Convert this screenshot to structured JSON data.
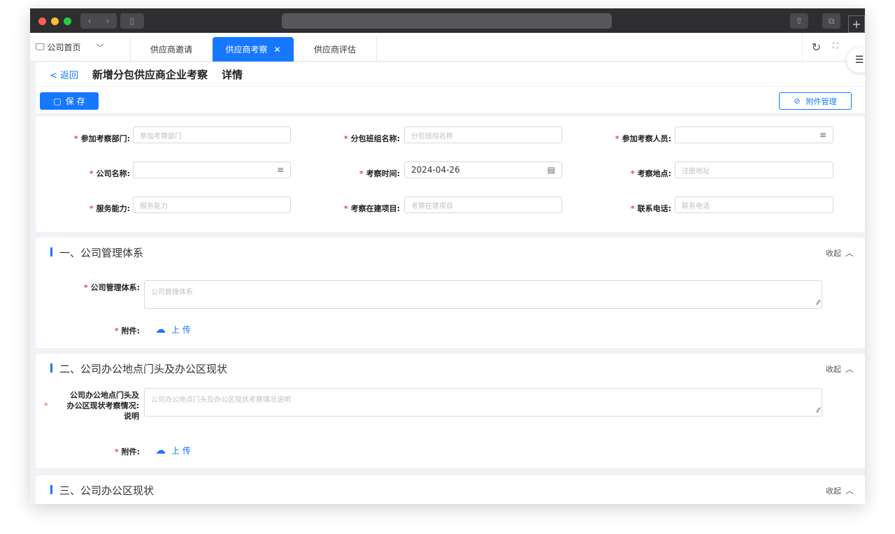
{
  "browser": {
    "nav_back_icon": "chevron-left-icon",
    "nav_forward_icon": "chevron-right-icon",
    "back_glyph": "‹",
    "forward_glyph": "›",
    "sidebar_glyph": "▯",
    "share_glyph": "⇧",
    "tabs_glyph": "⧉",
    "plus_glyph": "+"
  },
  "tabs": {
    "home_label": "公司首页",
    "home_icon_glyph": "🖵",
    "chevron_glyph": "﹀",
    "items": [
      {
        "label": "供应商邀请"
      },
      {
        "label": "供应商考察",
        "active": true
      },
      {
        "label": "供应商评估"
      }
    ],
    "close_glyph": "✕",
    "refresh_glyph": "↻",
    "fullscreen_glyph": "⛶",
    "settings_glyph": "☰"
  },
  "header": {
    "back_label": "< 返回",
    "title": "新增分包供应商企业考察",
    "subtitle": "详情"
  },
  "toolbar": {
    "save_label": "保 存",
    "save_icon_glyph": "▢",
    "attach_label": "附件管理",
    "attach_icon_glyph": "⊘"
  },
  "form": {
    "required_mark": "*",
    "dept_label": "参加考察部门:",
    "dept_placeholder": "参加考察部门",
    "team_label": "分包班组名称:",
    "team_placeholder": "分包班组名称",
    "staff_label": "参加考察人员:",
    "company_label": "公司名称:",
    "time_label": "考察时间:",
    "time_value": "2024-04-26",
    "place_label": "考察地点:",
    "place_placeholder": "注册地址",
    "service_label": "服务能力:",
    "service_placeholder": "服务能力",
    "project_label": "考察在建项目:",
    "project_placeholder": "考察在建项目",
    "phone_label": "联系电话:",
    "phone_placeholder": "联系电话",
    "filter_glyph": "≡",
    "calendar_glyph": "▤"
  },
  "sections": [
    {
      "title": "一、公司管理体系",
      "collapse_label": "收起",
      "field_label": "公司管理体系:",
      "field_placeholder": "公司管理体系",
      "attach_label": "附件:",
      "upload_label": "上 传"
    },
    {
      "title": "二、公司办公地点门头及办公区现状",
      "collapse_label": "收起",
      "field_label_1": "公司办公地点门头及",
      "field_label_2": "办公区现状考察情况:",
      "field_label_3": "说明",
      "field_placeholder": "公司办公地点门头及办公区现状考察情况说明",
      "attach_label": "附件:",
      "upload_label": "上 传"
    },
    {
      "title": "三、公司办公区现状",
      "collapse_label": "收起"
    }
  ],
  "glyphs": {
    "chevron_up": "︿",
    "upload": "☁",
    "grip": "⁄⁄"
  },
  "colors": {
    "primary": "#1677ff",
    "required": "#e54545",
    "titlebar": "#2e2e30"
  }
}
